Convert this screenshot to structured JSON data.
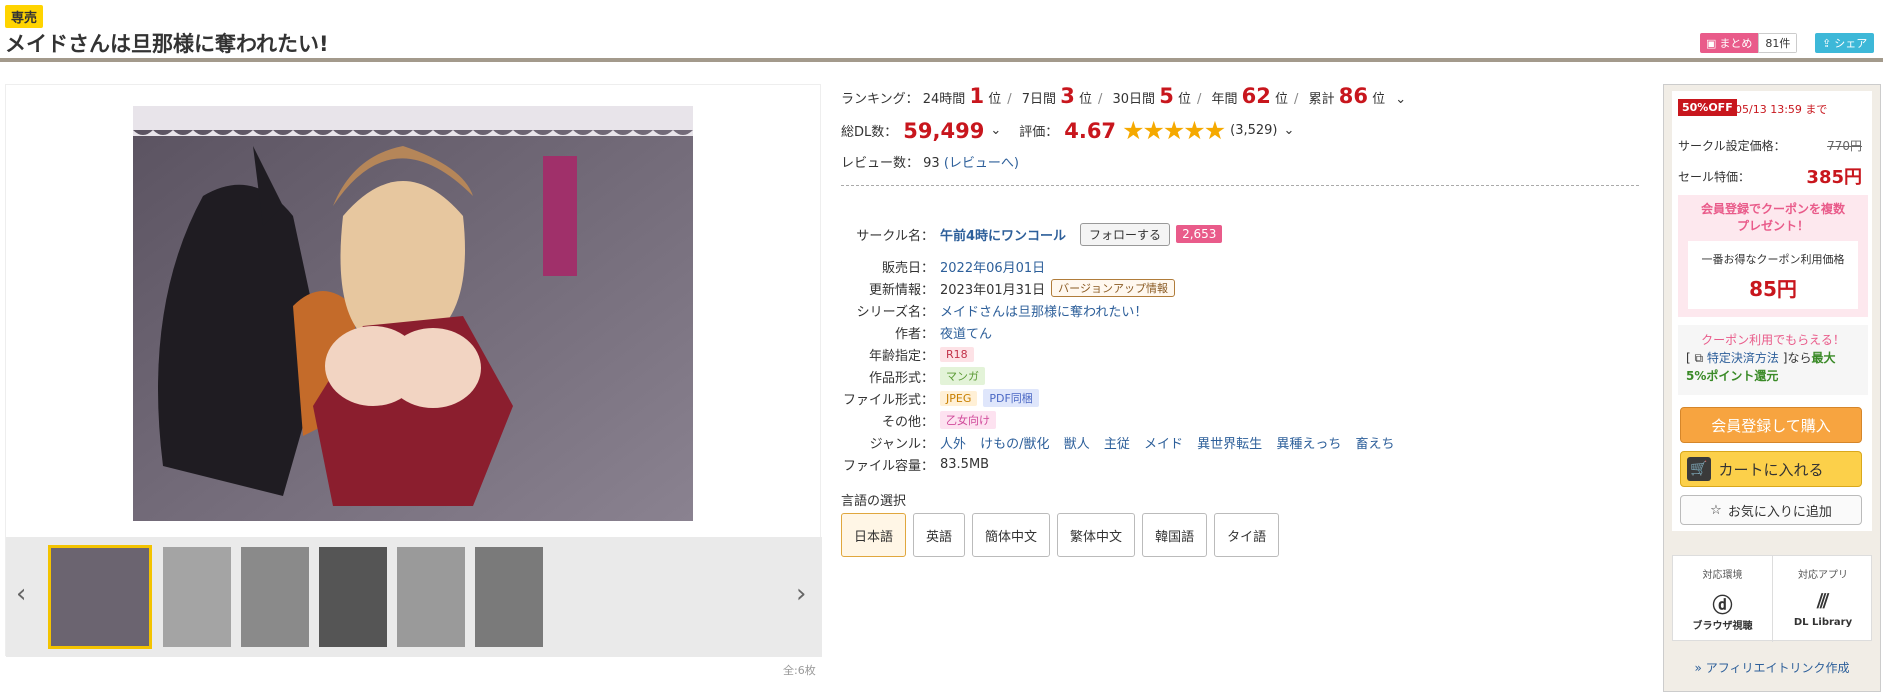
{
  "header": {
    "badge": "専売",
    "title": "メイドさんは旦那様に奪われたい!",
    "matome_label": "まとめ",
    "matome_count": "81件",
    "share_label": "シェア"
  },
  "gallery": {
    "page_count": "全:6枚"
  },
  "ranking": {
    "label": "ランキング：",
    "items": [
      {
        "period": "24時間",
        "rank": "1",
        "unit": "位"
      },
      {
        "period": "7日間",
        "rank": "3",
        "unit": "位"
      },
      {
        "period": "30日間",
        "rank": "5",
        "unit": "位"
      },
      {
        "period": "年間",
        "rank": "62",
        "unit": "位"
      },
      {
        "period": "累計",
        "rank": "86",
        "unit": "位"
      }
    ]
  },
  "stats": {
    "dl_label": "総DL数：",
    "dl_count": "59,499",
    "rating_label": "評価：",
    "rating": "4.67",
    "rating_count": "(3,529)",
    "review_label": "レビュー数：",
    "review_count": "93",
    "review_link": "(レビューへ)"
  },
  "spec": {
    "circle_label": "サークル名：",
    "circle_name": "午前4時にワンコール",
    "follow_label": "フォローする",
    "follow_count": "2,653",
    "release_label": "販売日：",
    "release_date": "2022年06月01日",
    "update_label": "更新情報：",
    "update_date": "2023年01月31日",
    "update_tag": "バージョンアップ情報",
    "series_label": "シリーズ名：",
    "series_name": "メイドさんは旦那様に奪われたい！",
    "author_label": "作者：",
    "author_name": "夜道てん",
    "age_label": "年齢指定：",
    "age_tag": "R18",
    "format_label": "作品形式：",
    "format_tag": "マンガ",
    "file_label": "ファイル形式：",
    "file_tag1": "JPEG",
    "file_tag2": "PDF同梱",
    "other_label": "その他：",
    "other_tag": "乙女向け",
    "genre_label": "ジャンル：",
    "genres": [
      "人外",
      "けもの/獣化",
      "獣人",
      "主従",
      "メイド",
      "異世界転生",
      "異種えっち",
      "畜えち"
    ],
    "size_label": "ファイル容量：",
    "size_value": "83.5MB"
  },
  "language": {
    "label": "言語の選択",
    "options": [
      "日本語",
      "英語",
      "簡体中文",
      "繁体中文",
      "韓国語",
      "タイ語"
    ]
  },
  "sidebar": {
    "off_badge": "50%OFF",
    "sale_until": "05/13 13:59 まで",
    "circle_price_label": "サークル設定価格：",
    "circle_price": "770円",
    "sale_price_label": "セール特価：",
    "sale_price": "385円",
    "coupon_title_1": "会員登録でクーポンを複数",
    "coupon_title_2": "プレゼント！",
    "coupon_inner_label": "一番お得なクーポン利用価格",
    "coupon_price": "85円",
    "coupon_points": "クーポン利用でもらえる！",
    "point_link": "特定決済方法",
    "point_pre": "[",
    "point_mid": "]なら",
    "point_max": "最大",
    "point_value": "5%ポイント還元",
    "register_buy": "会員登録して購入",
    "add_cart": "カートに入れる",
    "add_fav": "お気に入りに追加",
    "env_label": "対応環境",
    "env_name": "ブラウザ視聴",
    "app_label": "対応アプリ",
    "app_name": "DL Library",
    "affiliate": "» アフィリエイトリンク作成"
  }
}
